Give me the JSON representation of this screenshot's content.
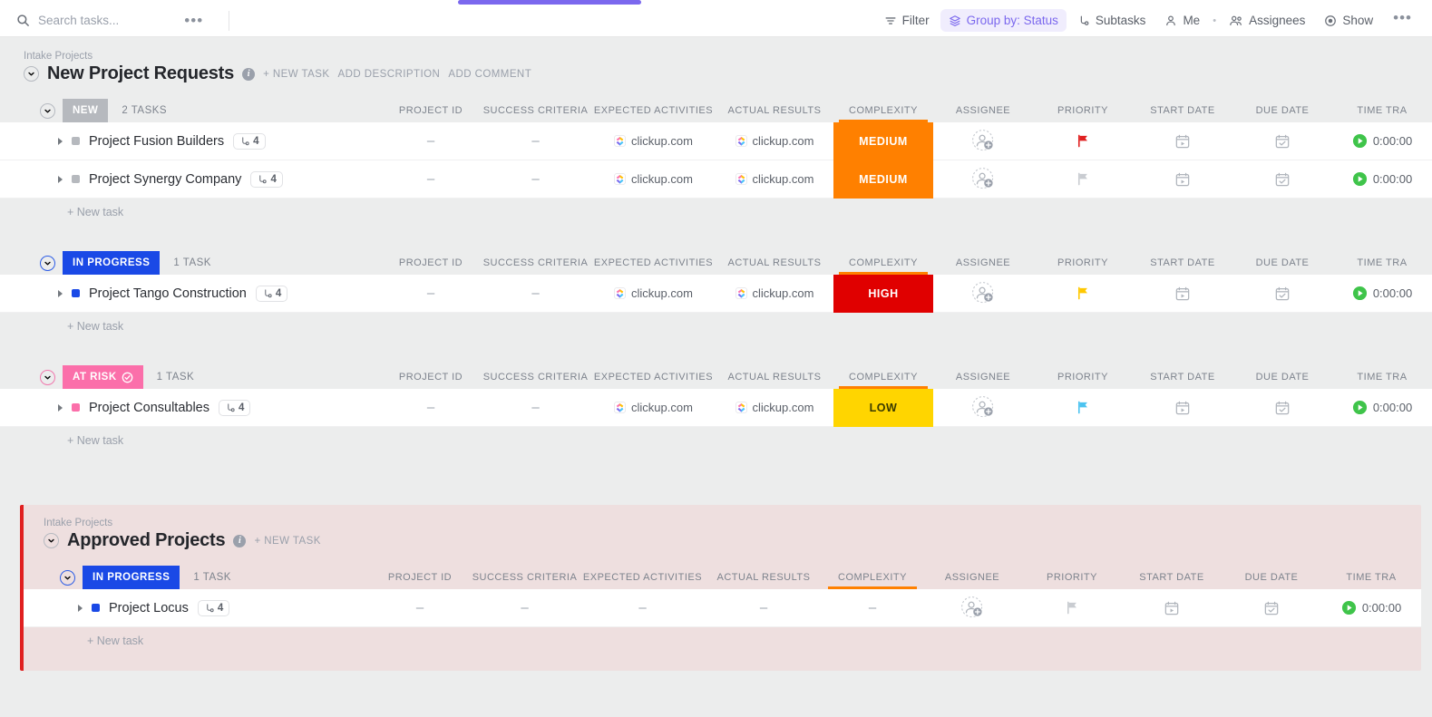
{
  "toolbar": {
    "search_placeholder": "Search tasks...",
    "overflow_label": "•••",
    "filter_label": "Filter",
    "group_by_label": "Group by: Status",
    "subtasks_label": "Subtasks",
    "me_label": "Me",
    "separator": "•",
    "assignees_label": "Assignees",
    "show_label": "Show",
    "more_label": "•••",
    "accent_color": "#7b68ee"
  },
  "columns": [
    {
      "key": "project_id",
      "label": "PROJECT ID",
      "underlined": false
    },
    {
      "key": "success_criteria",
      "label": "SUCCESS CRITERIA",
      "underlined": false
    },
    {
      "key": "expected_activities",
      "label": "EXPECTED ACTIVITIES",
      "underlined": false
    },
    {
      "key": "actual_results",
      "label": "ACTUAL RESULTS",
      "underlined": false
    },
    {
      "key": "complexity",
      "label": "COMPLEXITY",
      "underlined": true
    },
    {
      "key": "assignee",
      "label": "ASSIGNEE",
      "underlined": false
    },
    {
      "key": "priority",
      "label": "PRIORITY",
      "underlined": false
    },
    {
      "key": "start_date",
      "label": "START DATE",
      "underlined": false
    },
    {
      "key": "due_date",
      "label": "DUE DATE",
      "underlined": false
    },
    {
      "key": "time_tracked",
      "label": "TIME TRA",
      "underlined": false
    }
  ],
  "new_task_label": "+ New task",
  "sections": [
    {
      "breadcrumb": "Intake Projects",
      "title": "New Project Requests",
      "highlight": false,
      "actions": [
        "+ NEW TASK",
        "ADD DESCRIPTION",
        "ADD COMMENT"
      ],
      "groups": [
        {
          "status": "NEW",
          "status_key": "new",
          "has_check": false,
          "count_label": "2 TASKS",
          "show_colheads": true,
          "tasks": [
            {
              "name": "Project Fusion Builders",
              "subtask_count": "4",
              "project_id": "–",
              "success_criteria": "–",
              "expected_activities": "clickup.com",
              "actual_results": "clickup.com",
              "complexity": "MEDIUM",
              "complexity_key": "medium",
              "priority_color": "#e02020",
              "time_tracked": "0:00:00"
            },
            {
              "name": "Project Synergy Company",
              "subtask_count": "4",
              "project_id": "–",
              "success_criteria": "–",
              "expected_activities": "clickup.com",
              "actual_results": "clickup.com",
              "complexity": "MEDIUM",
              "complexity_key": "medium",
              "priority_color": "#c9ccd1",
              "time_tracked": "0:00:00"
            }
          ]
        },
        {
          "status": "IN PROGRESS",
          "status_key": "inprogress",
          "has_check": false,
          "count_label": "1 TASK",
          "show_colheads": true,
          "tasks": [
            {
              "name": "Project Tango Construction",
              "subtask_count": "4",
              "project_id": "–",
              "success_criteria": "–",
              "expected_activities": "clickup.com",
              "actual_results": "clickup.com",
              "complexity": "HIGH",
              "complexity_key": "high",
              "priority_color": "#ffc800",
              "time_tracked": "0:00:00"
            }
          ]
        },
        {
          "status": "AT RISK",
          "status_key": "atrisk",
          "has_check": true,
          "count_label": "1 TASK",
          "show_colheads": true,
          "tasks": [
            {
              "name": "Project Consultables",
              "subtask_count": "4",
              "project_id": "–",
              "success_criteria": "–",
              "expected_activities": "clickup.com",
              "actual_results": "clickup.com",
              "complexity": "LOW",
              "complexity_key": "low",
              "priority_color": "#4cc3f0",
              "time_tracked": "0:00:00"
            }
          ]
        }
      ]
    },
    {
      "breadcrumb": "Intake Projects",
      "title": "Approved Projects",
      "highlight": true,
      "highlight_color": "#e02020",
      "actions": [
        "+ NEW TASK"
      ],
      "groups": [
        {
          "status": "IN PROGRESS",
          "status_key": "inprogress",
          "has_check": false,
          "count_label": "1 TASK",
          "show_colheads": true,
          "tasks": [
            {
              "name": "Project Locus",
              "subtask_count": "4",
              "project_id": "–",
              "success_criteria": "–",
              "expected_activities": "–",
              "actual_results": "–",
              "complexity": "",
              "complexity_key": "empty",
              "complexity_dash": "–",
              "priority_color": "#c9ccd1",
              "time_tracked": "0:00:00"
            }
          ]
        }
      ]
    }
  ]
}
